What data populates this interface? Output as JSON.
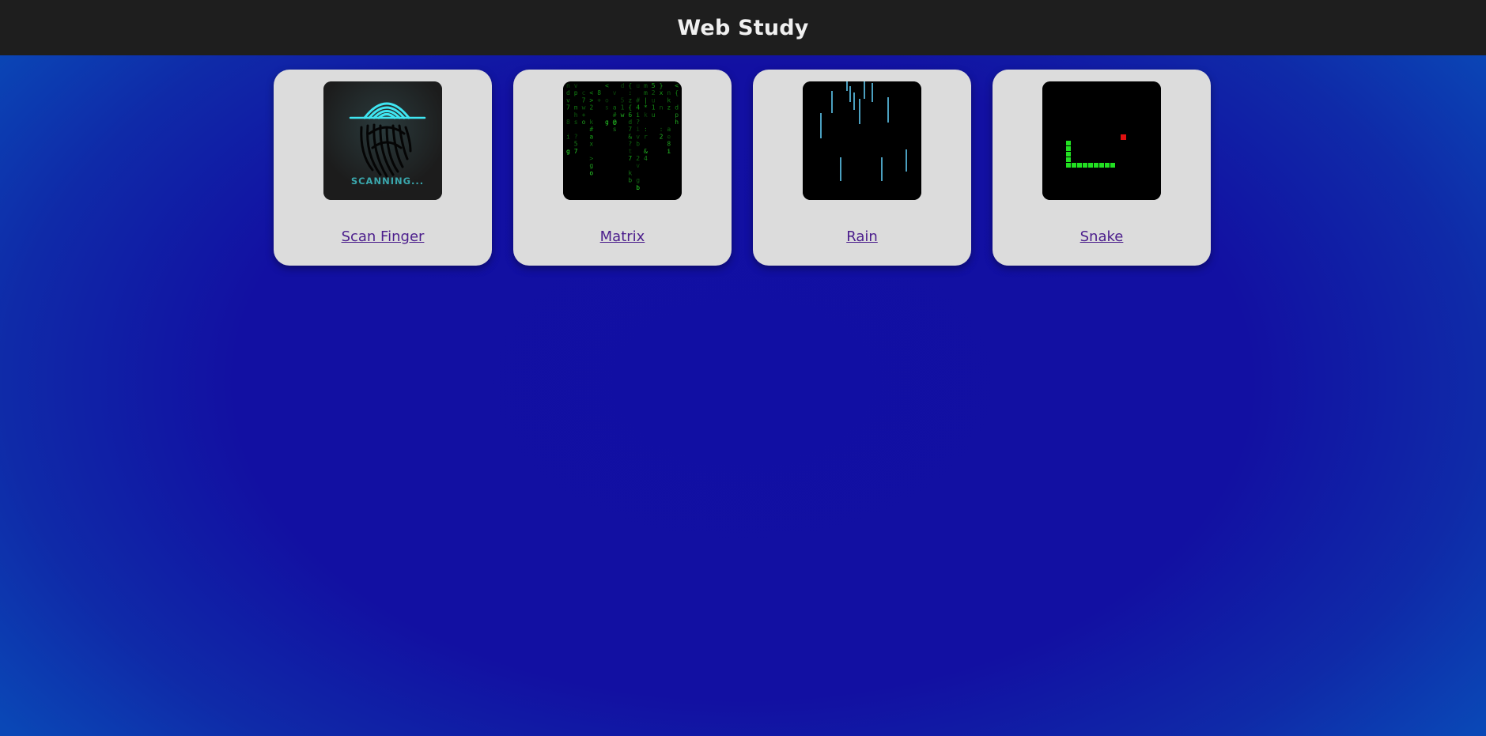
{
  "header": {
    "title": "Web Study"
  },
  "cards": [
    {
      "label": "Scan Finger",
      "thumb_icon": "fingerprint-icon",
      "thumb_text": "SCANNING..."
    },
    {
      "label": "Matrix",
      "thumb_icon": "matrix-rain-icon"
    },
    {
      "label": "Rain",
      "thumb_icon": "rain-icon"
    },
    {
      "label": "Snake",
      "thumb_icon": "snake-game-icon"
    }
  ],
  "colors": {
    "header_bg": "#1e1e1e",
    "page_bg": "#1210a2",
    "card_bg": "#dcdcdc",
    "link": "#4b1d8c",
    "scan_cyan": "#3fe6f2",
    "matrix_green": "#18c418",
    "rain_blue": "#5ec8f0",
    "snake_green": "#22e022",
    "snake_food": "#e01010"
  }
}
